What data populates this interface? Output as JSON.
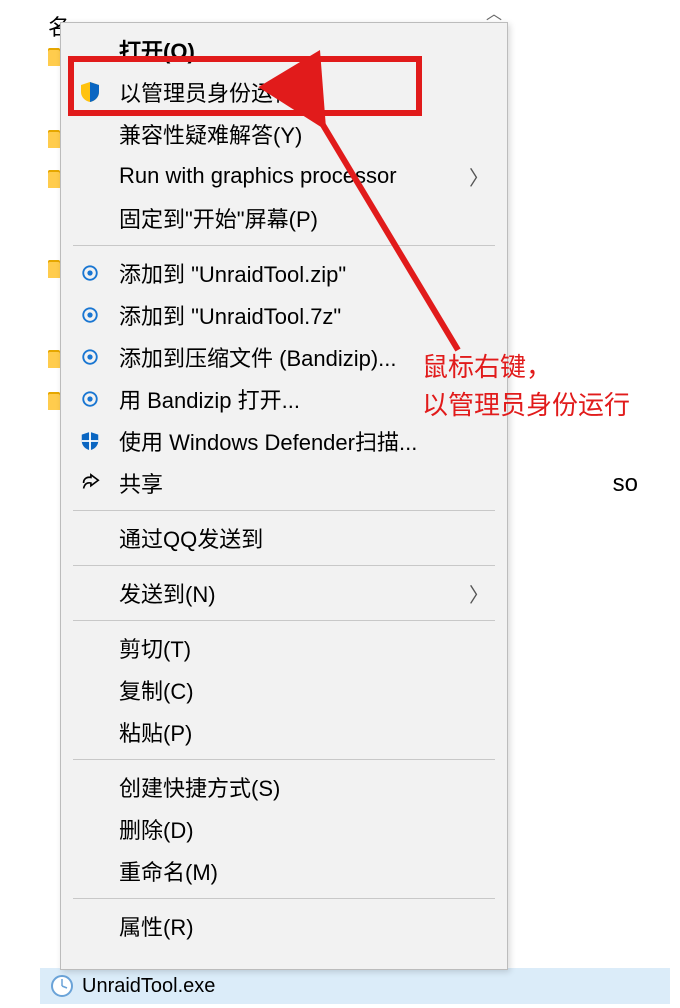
{
  "bg": {
    "col_header": "名",
    "iso_fragment": "so",
    "selected_file": "UnraidTool.exe"
  },
  "menu": {
    "open": "打开(O)",
    "run_admin": "以管理员身份运行(A)",
    "compat_troubleshoot": "兼容性疑难解答(Y)",
    "run_graphics": "Run with graphics processor",
    "pin_start": "固定到\"开始\"屏幕(P)",
    "add_zip": "添加到 \"UnraidTool.zip\"",
    "add_7z": "添加到 \"UnraidTool.7z\"",
    "add_archive": "添加到压缩文件 (Bandizip)...",
    "open_bandizip": "用 Bandizip 打开...",
    "defender_scan": "使用 Windows Defender扫描...",
    "share": "共享",
    "send_qq": "通过QQ发送到",
    "send_to": "发送到(N)",
    "cut": "剪切(T)",
    "copy": "复制(C)",
    "paste": "粘贴(P)",
    "create_shortcut": "创建快捷方式(S)",
    "delete": "删除(D)",
    "rename": "重命名(M)",
    "properties": "属性(R)"
  },
  "annotation": {
    "line1": "鼠标右键，",
    "line2": "以管理员身份运行"
  }
}
